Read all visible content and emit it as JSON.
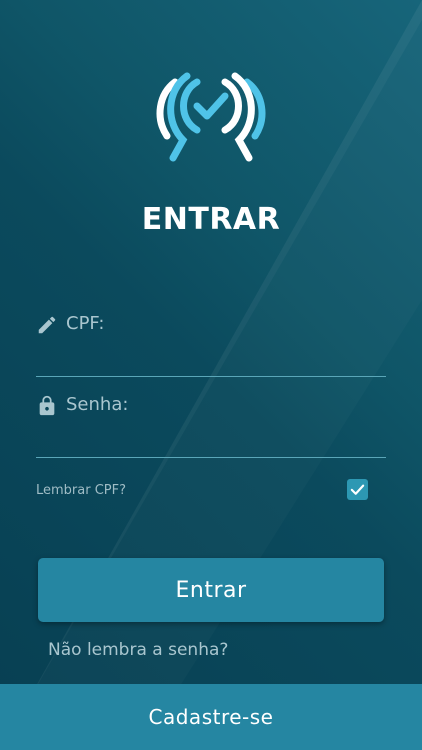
{
  "app": {
    "title": "ENTRAR"
  },
  "icons": {
    "logo": "shield-check-logo",
    "cpf": "pencil-icon",
    "senha": "lock-icon",
    "remember": "checkmark-icon"
  },
  "form": {
    "cpf_label": "CPF:",
    "cpf_value": "",
    "senha_label": "Senha:",
    "senha_value": "",
    "remember_label": "Lembrar CPF?",
    "remember_checked": true
  },
  "actions": {
    "login_label": "Entrar",
    "forgot_label": "Não lembra a senha?",
    "signup_label": "Cadastre-se"
  },
  "colors": {
    "primary": "#2586a2",
    "accent": "#4fc3e8",
    "background_dark": "#073f52",
    "background_light": "#17657a"
  }
}
